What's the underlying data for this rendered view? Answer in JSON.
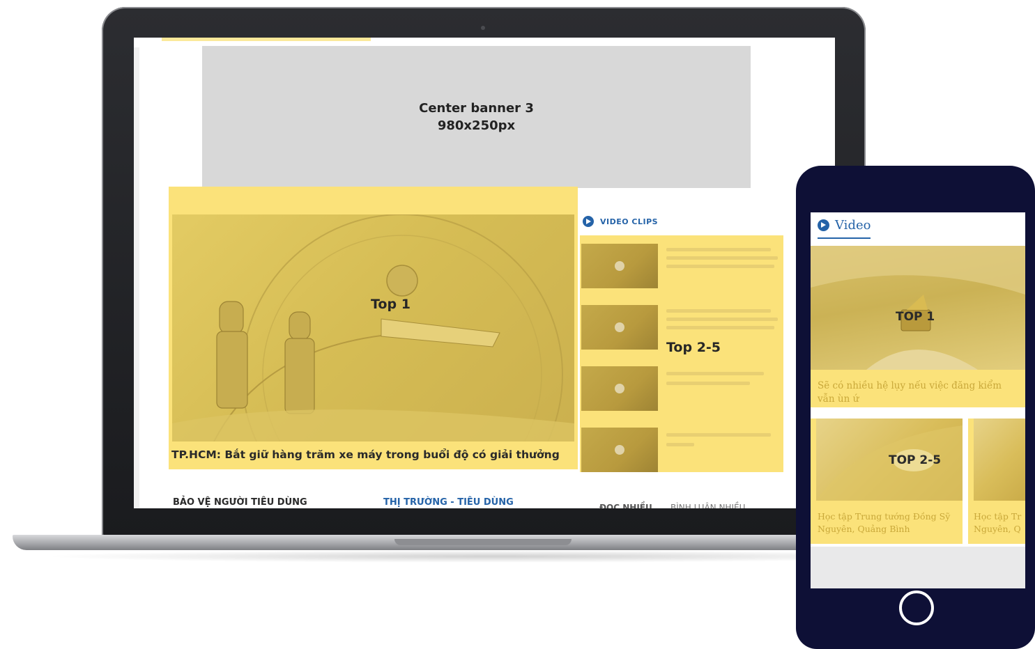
{
  "laptop": {
    "banner": {
      "line1": "Center banner 3",
      "line2": "980x250px"
    },
    "top1": {
      "label": "Top 1",
      "caption": "TP.HCM: Bắt giữ hàng trăm xe máy trong buổi độ có giải thưởng"
    },
    "video_clips": {
      "heading": "VIDEO CLIPS",
      "top25_label": "Top 2-5"
    },
    "sections": {
      "left": "BẢO VỆ NGƯỜI TIÊU DÙNG",
      "middle": "THỊ TRƯỜNG - TIÊU DÙNG",
      "tab_1": "ĐỌC NHIỀU",
      "tab_2": "BÌNH LUẬN NHIỀU"
    }
  },
  "phone": {
    "heading": "Video",
    "top1": {
      "label": "TOP 1",
      "caption": "Sẽ có nhiều hệ lụy nếu việc đăng kiểm vẫn ùn ứ"
    },
    "top25": {
      "label": "TOP 2-5",
      "card1_line1": "Học tập Trung tướng Đồng Sỹ",
      "card1_line2": "Nguyên, Quảng Bình",
      "card2_line1": "Học tập Tr",
      "card2_line2": "Nguyên, Q"
    }
  },
  "colors": {
    "highlight_yellow": "#fbe27a",
    "accent_blue": "#2563a8",
    "phone_body": "#0e1036",
    "banner_gray": "#d8d8d8"
  }
}
